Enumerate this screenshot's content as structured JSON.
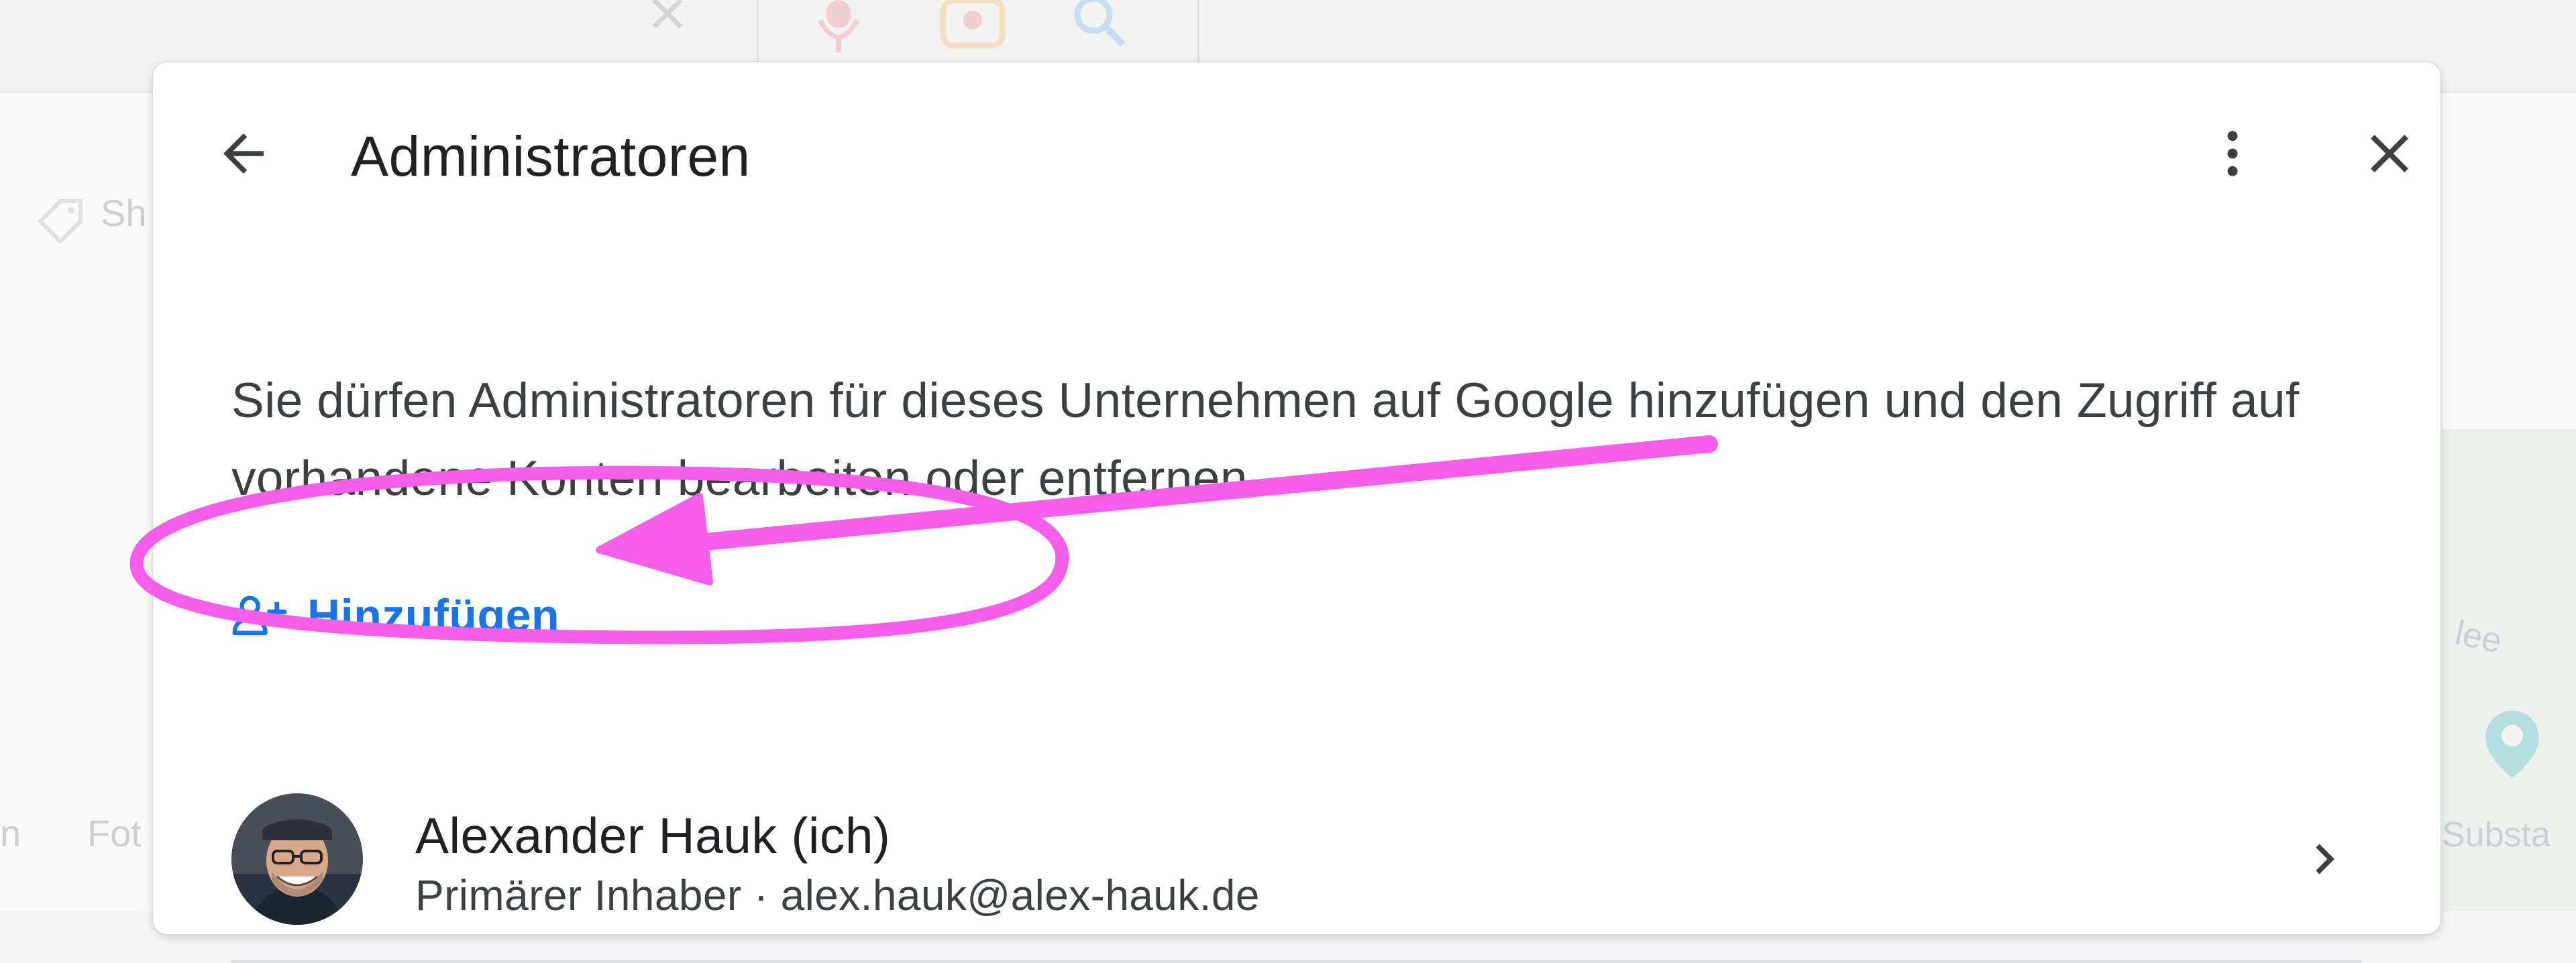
{
  "background": {
    "partial_left_label": "Sh",
    "partial_bottom_label": "Fot",
    "partial_bottom_left": "n",
    "map_label_lee": "lee",
    "map_label_substa": "Substa"
  },
  "dialog": {
    "title": "Administratoren",
    "description": "Sie dürfen Administratoren für dieses Unternehmen auf Google hinzufügen und den Zugriff auf vorhandene Konten bearbeiten oder entfernen.",
    "add_label": "Hinzufügen",
    "admins": [
      {
        "name": "Alexander Hauk (ich)",
        "subtitle": "Primärer Inhaber · alex.hauk@alex-hauk.de"
      }
    ]
  },
  "icons": {
    "back": "arrow-back-icon",
    "more": "more-vert-icon",
    "close": "close-icon",
    "add": "person-add-icon",
    "chevron": "chevron-right-icon"
  },
  "colors": {
    "accent": "#1a73e8",
    "annotation": "#f45ee8",
    "title": "#202124",
    "text": "#3c4043"
  }
}
